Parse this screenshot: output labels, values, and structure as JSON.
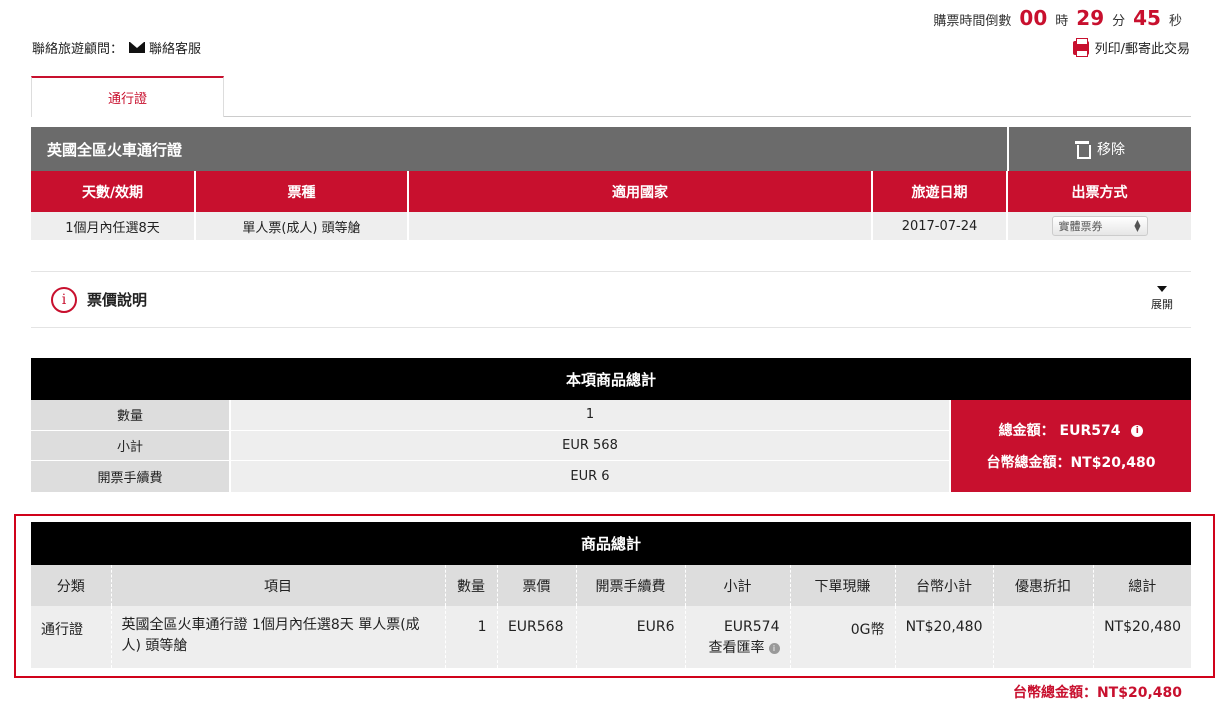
{
  "countdown": {
    "label": "購票時間倒數",
    "hours": "00",
    "hours_unit": "時",
    "minutes": "29",
    "minutes_unit": "分",
    "seconds": "45",
    "seconds_unit": "秒"
  },
  "contact": {
    "label": "聯絡旅遊顧問：",
    "link": "聯絡客服"
  },
  "print_link": "列印/郵寄此交易",
  "tabs": [
    {
      "label": "通行證"
    }
  ],
  "product": {
    "title": "英國全區火車通行證",
    "remove_label": "移除",
    "headers": [
      "天數/效期",
      "票種",
      "適用國家",
      "旅遊日期",
      "出票方式"
    ],
    "row": {
      "duration": "1個月內任選8天",
      "ticket_type": "單人票(成人) 頭等艙",
      "countries": "",
      "travel_date": "2017-07-24",
      "delivery": "實體票券"
    }
  },
  "fare_note": {
    "label": "票價說明",
    "expand_label": "展開"
  },
  "item_total": {
    "title": "本項商品總計",
    "rows": [
      {
        "label": "數量",
        "value": "1"
      },
      {
        "label": "小計",
        "value": "EUR 568"
      },
      {
        "label": "開票手續費",
        "value": "EUR 6"
      }
    ],
    "total_label": "總金額：",
    "total_value": "EUR574",
    "twd_label": "台幣總金額：",
    "twd_value": "NT$20,480"
  },
  "grand_total": {
    "title": "商品總計",
    "headers": [
      "分類",
      "項目",
      "數量",
      "票價",
      "開票手續費",
      "小計",
      "下單現賺",
      "台幣小計",
      "優惠折扣",
      "總計"
    ],
    "row": {
      "category": "通行證",
      "item": "英國全區火車通行證 1個月內任選8天 單人票(成人) 頭等艙",
      "qty": "1",
      "price": "EUR568",
      "fee": "EUR6",
      "subtotal": "EUR574",
      "rate_link": "查看匯率",
      "cashback": "0G幣",
      "twd_subtotal": "NT$20,480",
      "discount": "",
      "total": "NT$20,480"
    }
  },
  "footer_total": "台幣總金額：NT$20,480",
  "colors": {
    "accent": "#c8102e",
    "header_grey": "#6b6b6b",
    "black": "#000000"
  }
}
